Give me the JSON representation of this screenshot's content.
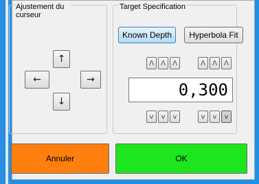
{
  "cursor_panel": {
    "title": "Ajustement du curseur",
    "up_icon": "↑",
    "down_icon": "↓",
    "left_icon": "←",
    "right_icon": "→"
  },
  "target_panel": {
    "title": "Target Specification",
    "tabs": [
      {
        "label": "Known Depth",
        "active": true
      },
      {
        "label": "Hyperbola Fit",
        "active": false
      }
    ],
    "increment_icon": "Λ",
    "decrement_icon": "v",
    "value": "0,300"
  },
  "actions": {
    "cancel_label": "Annuler",
    "cancel_color": "#ff7f0e",
    "ok_label": "OK",
    "ok_color": "#1ee61e"
  }
}
